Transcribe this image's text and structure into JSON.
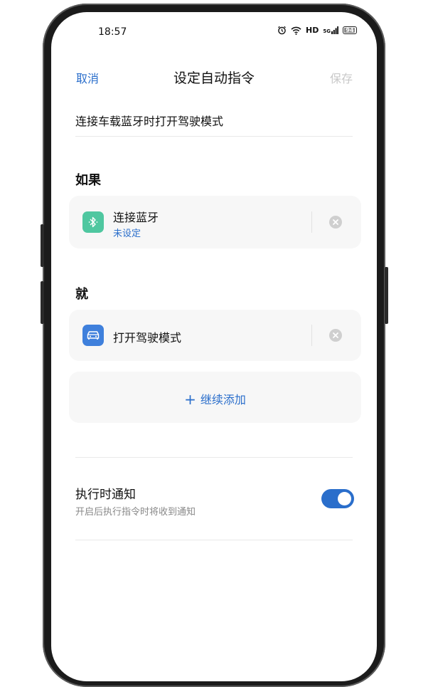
{
  "status_bar": {
    "time": "18:57",
    "hd": "HD",
    "signal_text": "5G",
    "battery": "94"
  },
  "nav": {
    "cancel": "取消",
    "title": "设定自动指令",
    "save": "保存"
  },
  "command_name": "连接车载蓝牙时打开驾驶模式",
  "if_section": {
    "label": "如果",
    "card": {
      "title": "连接蓝牙",
      "subtitle": "未设定",
      "icon": "bluetooth-icon",
      "icon_color": "#4fc7a0"
    }
  },
  "then_section": {
    "label": "就",
    "card": {
      "title": "打开驾驶模式",
      "icon": "car-icon",
      "icon_color": "#3f80dc"
    },
    "add_more": "继续添加"
  },
  "notification": {
    "title": "执行时通知",
    "subtitle": "开启后执行指令时将收到通知",
    "enabled": true
  },
  "colors": {
    "accent": "#2a6ecb",
    "save_disabled": "#c8c8c8",
    "card_bg": "#f7f7f7"
  }
}
